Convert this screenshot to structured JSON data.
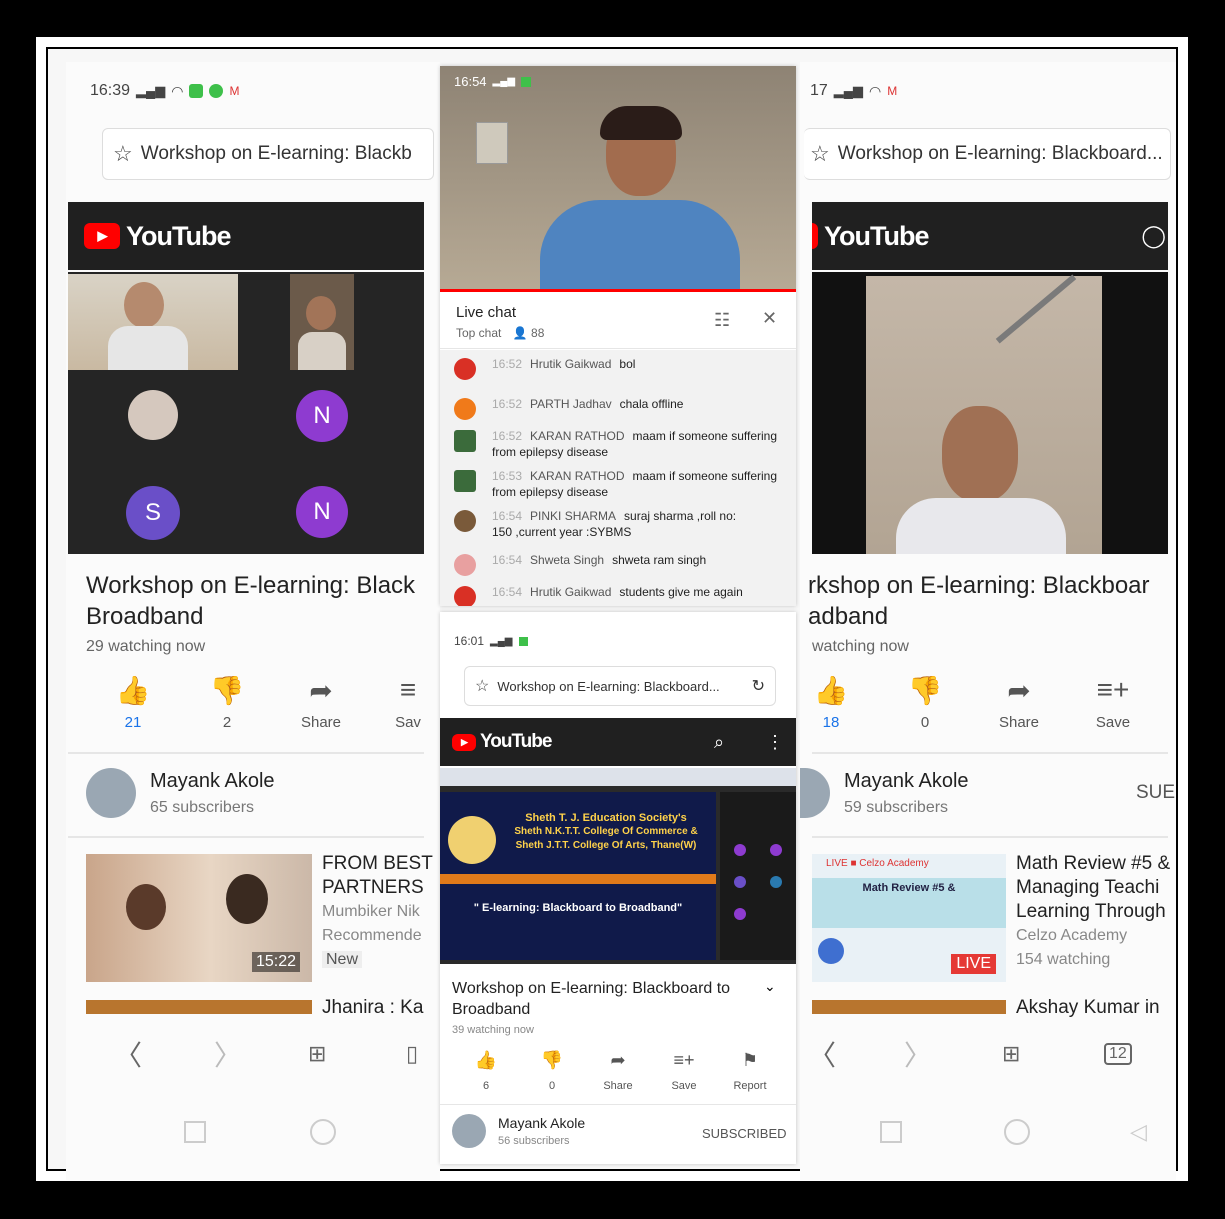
{
  "left": {
    "status_time": "16:39",
    "address": "Workshop on E-learning: Blackb",
    "yt_logo": "YouTube",
    "participants": [
      {
        "initial": "N",
        "color": "#8e3bd0"
      },
      {
        "initial": "S",
        "color": "#6a4fc8"
      },
      {
        "initial": "N",
        "color": "#8e3bd0"
      }
    ],
    "title_line1": "Workshop on E-learning: Black",
    "title_line2": "Broadband",
    "watching": "29 watching now",
    "actions": {
      "likes": "21",
      "dislikes": "2",
      "share": "Share",
      "save": "Sav"
    },
    "channel": {
      "name": "Mayank Akole",
      "subs": "65 subscribers"
    },
    "rec": {
      "line1": "FROM BEST",
      "line2": "PARTNERS",
      "line3": "Mumbiker Nik",
      "line4": "Recommende",
      "badge": "New",
      "duration": "15:22"
    },
    "rec2": "Jhanira : Ka"
  },
  "center_top": {
    "status_time": "16:54",
    "live_chat": "Live chat",
    "top_chat": "Top chat",
    "viewer_count": "88",
    "messages": [
      {
        "time": "16:52",
        "name": "Hrutik Gaikwad",
        "text": "bol",
        "color": "#d93025"
      },
      {
        "time": "16:52",
        "name": "PARTH Jadhav",
        "text": "chala offline",
        "color": "#f07a1a"
      },
      {
        "time": "16:52",
        "name": "KARAN RATHOD",
        "text": "maam if someone suffering",
        "text2": "from epilepsy disease",
        "color": "#3b6b3b"
      },
      {
        "time": "16:53",
        "name": "KARAN RATHOD",
        "text": "maam if someone suffering",
        "text2": "from epilepsy disease",
        "color": "#3b6b3b"
      },
      {
        "time": "16:54",
        "name": "PINKI SHARMA",
        "text": "suraj sharma ,roll no:",
        "text2": "150 ,current year :SYBMS",
        "color": "#7a5a3a"
      },
      {
        "time": "16:54",
        "name": "Shweta Singh",
        "text": "shweta ram singh",
        "color": "#e8a0a0"
      },
      {
        "time": "16:54",
        "name": "Hrutik Gaikwad",
        "text": "students give me again",
        "color": "#d93025"
      }
    ]
  },
  "center_bottom": {
    "status_time": "16:01",
    "address": "Workshop on E-learning: Blackboard...",
    "yt_logo": "YouTube",
    "banner_lines": [
      "Sheth T. J. Education Society's",
      "Sheth N.K.T.T. College Of Commerce &",
      "Sheth J.T.T. College Of Arts, Thane(W)"
    ],
    "banner_event": "\" E-learning: Blackboard to Broadband\"",
    "title_line1": "Workshop on E-learning: Blackboard to",
    "title_line2": "Broadband",
    "watching": "39 watching now",
    "actions": {
      "likes": "6",
      "dislikes": "0",
      "share": "Share",
      "save": "Save",
      "report": "Report"
    },
    "channel": {
      "name": "Mayank Akole",
      "subs": "56 subscribers",
      "button": "SUBSCRIBED"
    }
  },
  "right": {
    "status_time": "17",
    "address": "Workshop on E-learning: Blackboard...",
    "yt_logo": "YouTube",
    "title_line1": "rkshop on E-learning: Blackboar",
    "title_line2": "adband",
    "watching": "watching now",
    "actions": {
      "likes": "18",
      "dislikes": "0",
      "share": "Share",
      "save": "Save"
    },
    "channel": {
      "name": "Mayank Akole",
      "subs": "59 subscribers",
      "button": "SUE"
    },
    "rec": {
      "line1": "Math Review #5 &",
      "line2": "Managing Teachi",
      "line3": "Learning Through",
      "line4": "Celzo Academy",
      "line5": "154 watching",
      "live": "LIVE",
      "thumb_title": "Math Review #5 &",
      "thumb_brand": "LIVE ■ Celzo Academy"
    },
    "rec2": "Akshay Kumar in",
    "tabs_count": "12"
  },
  "colors": {
    "yt_red": "#ff0000",
    "like_blue": "#1a73e8",
    "frame": "#000000"
  }
}
